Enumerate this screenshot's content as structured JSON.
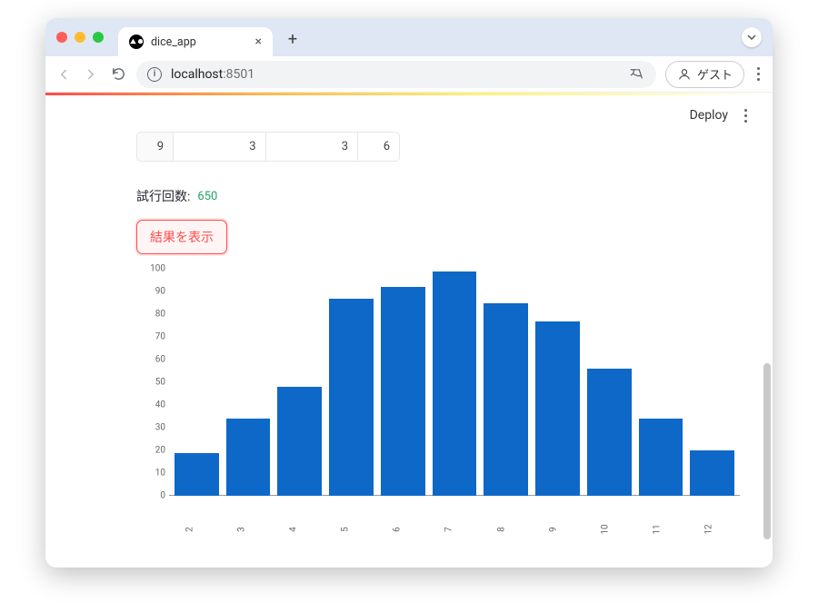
{
  "browser": {
    "tab_title": "dice_app",
    "url_host": "localhost",
    "url_port": ":8501",
    "guest_label": "ゲスト"
  },
  "app": {
    "deploy_label": "Deploy",
    "table_cells": [
      "9",
      "3",
      "3",
      "6"
    ],
    "trial_label": "試行回数:",
    "trial_count": "650",
    "result_button": "結果を表示"
  },
  "chart_data": {
    "type": "bar",
    "categories": [
      "2",
      "3",
      "4",
      "5",
      "6",
      "7",
      "8",
      "9",
      "10",
      "11",
      "12"
    ],
    "values": [
      19,
      34,
      48,
      87,
      92,
      99,
      85,
      77,
      56,
      34,
      20
    ],
    "yticks": [
      0,
      10,
      20,
      30,
      40,
      50,
      60,
      70,
      80,
      90,
      100
    ],
    "ylim": [
      0,
      100
    ],
    "title": "",
    "xlabel": "",
    "ylabel": ""
  }
}
